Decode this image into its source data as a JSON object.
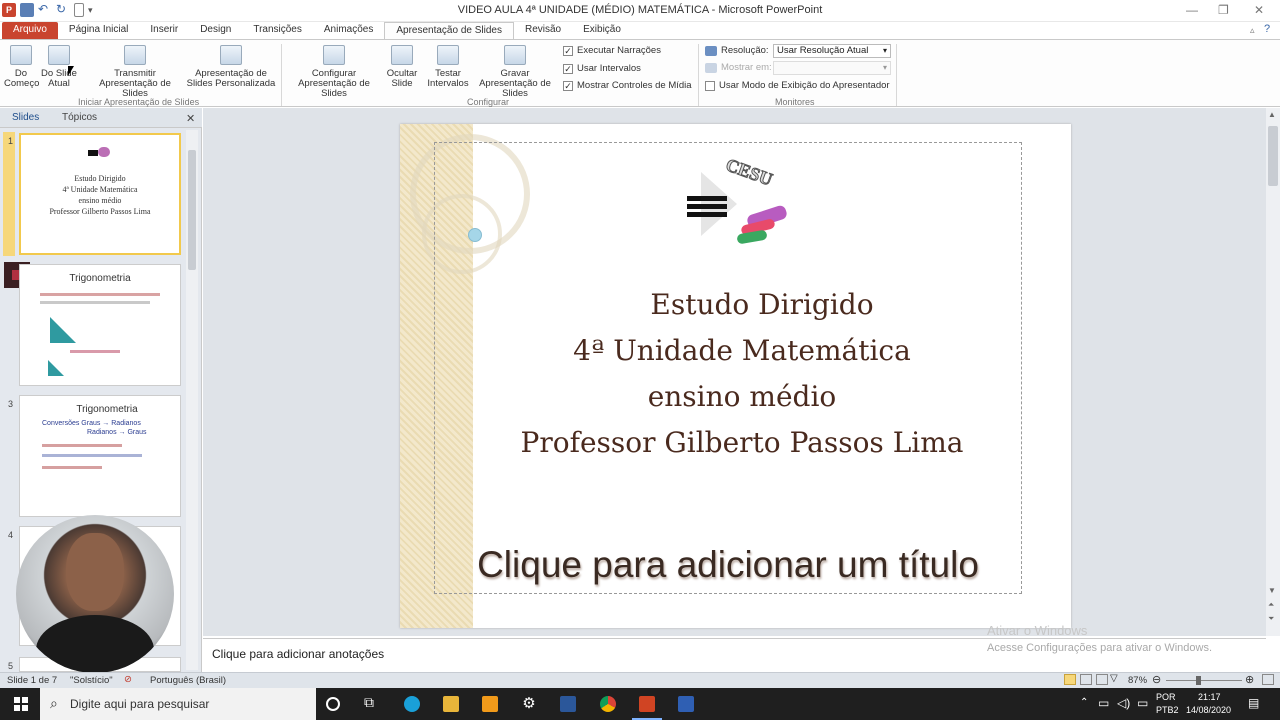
{
  "window": {
    "title": "VIDEO AULA 4ª UNIDADE (MÉDIO) MATEMÁTICA - Microsoft PowerPoint"
  },
  "tabs": [
    "Arquivo",
    "Página Inicial",
    "Inserir",
    "Design",
    "Transições",
    "Animações",
    "Apresentação de Slides",
    "Revisão",
    "Exibição"
  ],
  "ribbon": {
    "btn_start": "Do Começo",
    "btn_current": "Do Slide Atual",
    "btn_broadcast": "Transmitir Apresentação de Slides",
    "btn_custom": "Apresentação de Slides Personalizada",
    "group1": "Iniciar Apresentação de Slides",
    "btn_setup": "Configurar Apresentação de Slides",
    "btn_hide": "Ocultar Slide",
    "btn_rehearse": "Testar Intervalos",
    "btn_record": "Gravar Apresentação de Slides",
    "chk_narration": "Executar Narrações",
    "chk_timings": "Usar Intervalos",
    "chk_controls": "Mostrar Controles de Mídia",
    "group2": "Configurar",
    "resolution_label": "Resolução:",
    "resolution_value": "Usar Resolução Atual",
    "show_on_label": "Mostrar em:",
    "presenter_view": "Usar Modo de Exibição do Apresentador",
    "group3": "Monitores"
  },
  "leftpane": {
    "tab_slides": "Slides",
    "tab_outline": "Tópicos",
    "slide_numbers": [
      "1",
      "2",
      "3",
      "4",
      "5"
    ],
    "thumb1": {
      "lines": [
        "Estudo Dirigido",
        "4ª Unidade Matemática",
        "ensino médio",
        "Professor Gilberto Passos Lima"
      ]
    },
    "thumb2": {
      "title": "Trigonometria"
    },
    "thumb3": {
      "title": "Trigonometria",
      "line1": "Conversões  Graus → Radianos",
      "line2": "Radianos → Graus"
    }
  },
  "slide": {
    "logo_text": "CESU",
    "lines": [
      "Estudo Dirigido",
      "4ª Unidade Matemática",
      "ensino médio",
      "Professor Gilberto Passos Lima"
    ],
    "placeholder": "Clique para adicionar um título"
  },
  "notes": {
    "placeholder": "Clique para adicionar anotações",
    "activate_title": "Ativar o Windows",
    "activate_sub": "Acesse Configurações para ativar o Windows."
  },
  "status": {
    "slide_info": "Slide 1 de 7",
    "theme": "\"Solstício\"",
    "language": "Português (Brasil)",
    "zoom": "87%"
  },
  "taskbar": {
    "search_placeholder": "Digite aqui para pesquisar",
    "lang1": "POR",
    "lang2": "PTB2",
    "time": "21:17",
    "date": "14/08/2020"
  },
  "colors": {
    "file_tab": "#c9442f",
    "slide_text": "#4a2a1e",
    "placeholder_text": "#3a2a22",
    "selected_thumb": "#f2c94c",
    "slide_band": "#efe3c2"
  }
}
